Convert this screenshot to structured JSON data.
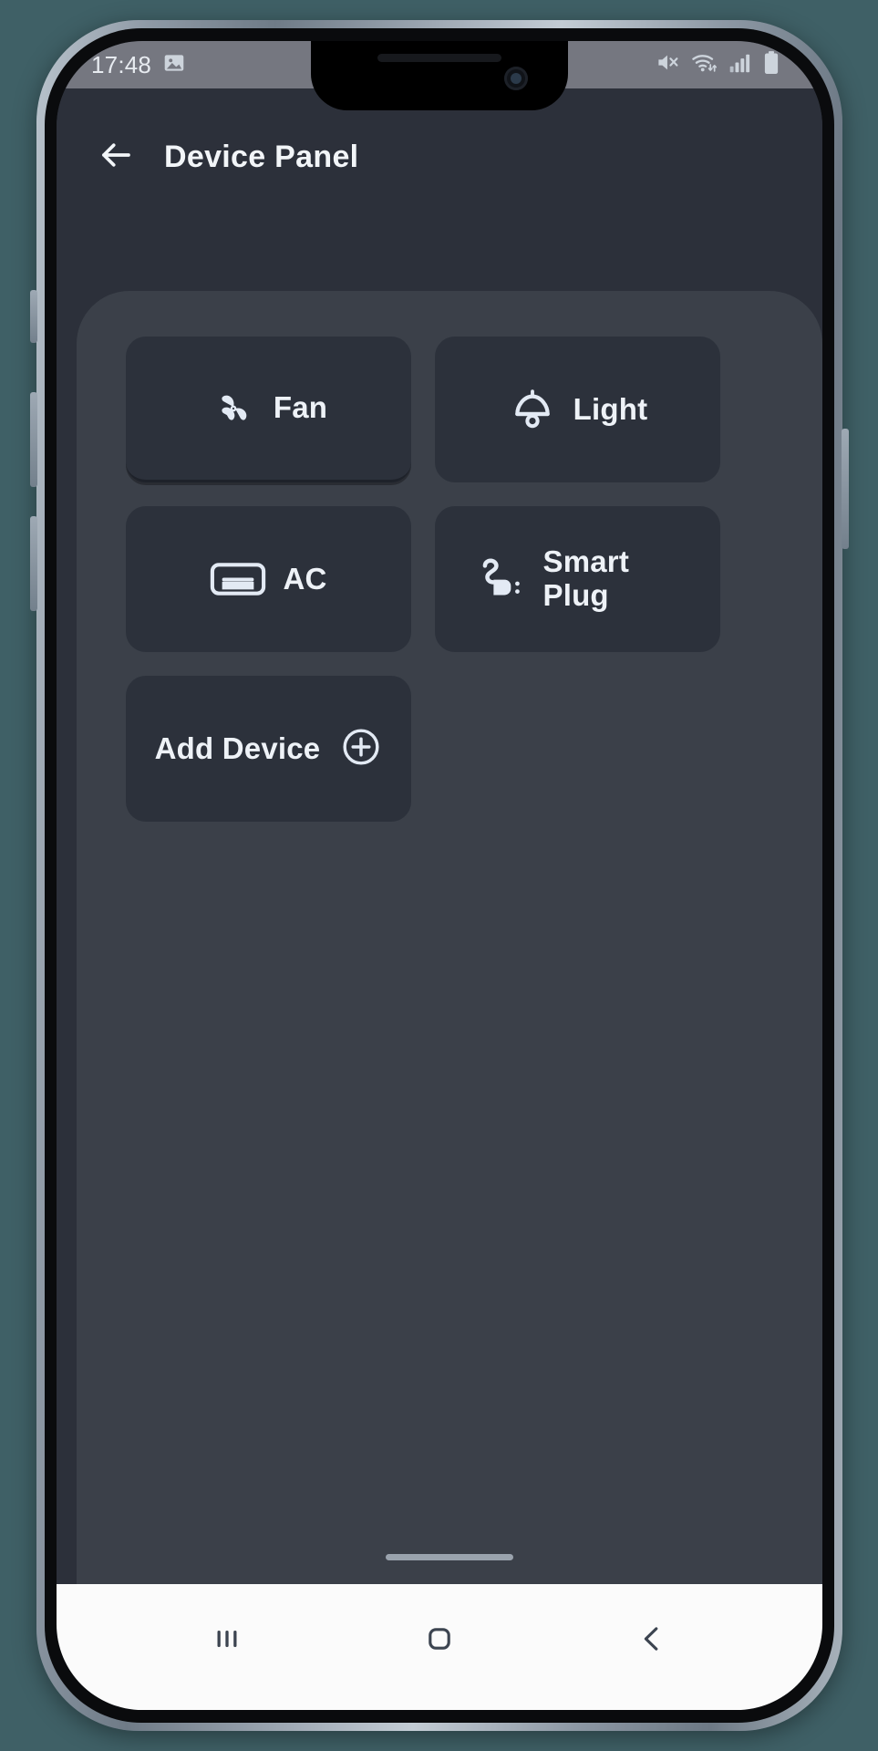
{
  "status_bar": {
    "time": "17:48",
    "left_icons": [
      "image-icon"
    ],
    "right_icons": [
      "mute-icon",
      "wifi-icon",
      "cellular-signal-icon",
      "battery-icon"
    ],
    "background_color": "#757780",
    "text_color": "#e7ebf0"
  },
  "app": {
    "title": "Device Panel",
    "back_icon": "arrow-left-icon",
    "background_color": "#2c303a",
    "panel_color": "#3b4049",
    "card_color": "#2c313b",
    "devices": [
      {
        "label": "Fan",
        "icon": "fan-icon",
        "selected": true
      },
      {
        "label": "Light",
        "icon": "ceiling-light-icon",
        "selected": false
      },
      {
        "label": "AC",
        "icon": "air-conditioner-icon",
        "selected": false
      },
      {
        "label": "Smart Plug",
        "icon": "power-plug-icon",
        "selected": false
      }
    ],
    "add_device": {
      "label": "Add Device",
      "icon": "plus-circle-icon"
    }
  },
  "nav_bar": {
    "background_color": "#fbfbfb",
    "buttons": [
      {
        "name": "recents",
        "icon": "recents-icon"
      },
      {
        "name": "home",
        "icon": "home-icon"
      },
      {
        "name": "back",
        "icon": "back-chevron-icon"
      }
    ]
  }
}
